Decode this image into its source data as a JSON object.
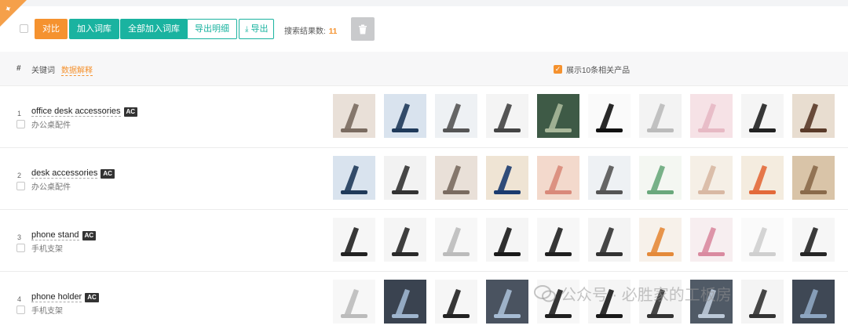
{
  "toolbar": {
    "compare_label": "对比",
    "add_lexicon_label": "加入词库",
    "add_all_lexicon_label": "全部加入词库",
    "export_detail_label": "导出明细",
    "export_label": "导出",
    "result_label": "搜索结果数:",
    "result_count": "11"
  },
  "table_header": {
    "hash": "#",
    "keyword": "关键词",
    "data_explain": "数据解释",
    "show_related": "展示10条相关产品",
    "show_related_checked": true
  },
  "rows": [
    {
      "index": "1",
      "keyword": "office desk accessories",
      "badge": "AC",
      "translation": "办公桌配件",
      "thumbs": [
        "pen-organizer",
        "monitor-memo-board",
        "phone-stand-clear",
        "gel-wrist-rest",
        "floral-desk-mat",
        "black-mouse-pad",
        "foot-rest-cushion",
        "pink-desk-mat",
        "desk-power-strip",
        "wood-desk-shelf"
      ]
    },
    {
      "index": "2",
      "keyword": "desk accessories",
      "badge": "AC",
      "translation": "办公桌配件",
      "thumbs": [
        "monitor-memo-board",
        "mini-desk-fan",
        "pen-organizer",
        "little-reminders-sign",
        "sticky-notes-stack",
        "phone-stand-clear",
        "planner-pad",
        "pastel-sticky-notes",
        "desk-calendar-12",
        "wood-desk-items",
        "desk-organizer-white"
      ]
    },
    {
      "index": "3",
      "keyword": "phone stand",
      "badge": "AC",
      "translation": "手机支架",
      "thumbs": [
        "foldable-stand-black",
        "adjustable-stand-dark",
        "folding-stand-white",
        "tablet-stand-black",
        "flat-stand-black",
        "holder-stand-black",
        "stand-orange-phone",
        "stand-pink-phone",
        "white-tall-stand",
        "stand-black-angled"
      ]
    },
    {
      "index": "4",
      "keyword": "phone holder",
      "badge": "AC",
      "translation": "手机支架",
      "thumbs": [
        "folding-stand-white",
        "car-vent-holder",
        "foldable-stand-black",
        "car-mount-holder",
        "flat-stand-black",
        "tablet-stand-black",
        "gooseneck-holder",
        "car-dash-holder",
        "holder-stand-black",
        "car-vent-holder-2"
      ]
    }
  ],
  "watermark": "公众号 · 必胜家的工板房",
  "colors": {
    "accent_orange": "#f5922f",
    "accent_teal": "#1ab3a0"
  }
}
